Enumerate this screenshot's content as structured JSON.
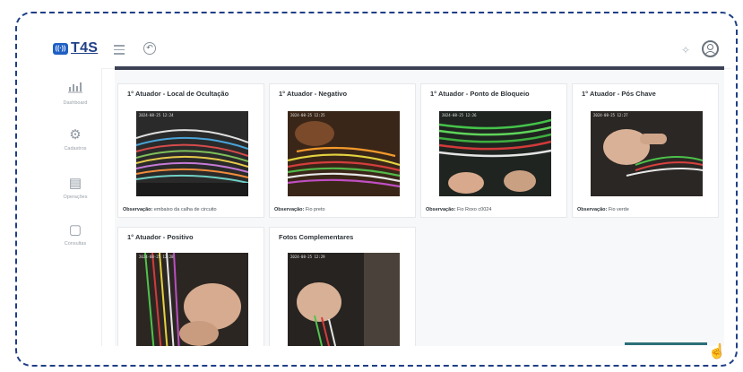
{
  "app": {
    "logo_badge": "((·))",
    "logo_text": "T4S"
  },
  "icons": {
    "menu": "menu-icon",
    "back": "back-icon",
    "sparkle": "sparkle-icon",
    "user": "user-avatar-icon",
    "cursor": "hand-pointer-icon"
  },
  "sidebar": {
    "items": [
      {
        "label": "Dashboard",
        "icon": "chart-icon",
        "glyph": "▥"
      },
      {
        "label": "Cadastros",
        "icon": "gears-icon",
        "glyph": "⚙"
      },
      {
        "label": "Operações",
        "icon": "clipboard-icon",
        "glyph": "▤"
      },
      {
        "label": "Consultas",
        "icon": "document-icon",
        "glyph": "▢"
      }
    ]
  },
  "cards": [
    {
      "title": "1° Atuador - Local de Ocultação",
      "timestamp": "2024-08-25 12:24",
      "obs_label": "Observação:",
      "obs_value": "embaixo da calha de circuito",
      "photo_theme": "wires-multicolor"
    },
    {
      "title": "1° Atuador - Negativo",
      "timestamp": "2024-08-25 12:25",
      "obs_label": "Observação:",
      "obs_value": "Fio preto",
      "photo_theme": "wires-red-green"
    },
    {
      "title": "1° Atuador - Ponto de Bloqueio",
      "timestamp": "2024-08-25 12:26",
      "obs_label": "Observação:",
      "obs_value": "Fio Roxo c0024",
      "photo_theme": "wires-green-hand"
    },
    {
      "title": "1° Atuador - Pós Chave",
      "timestamp": "2024-08-25 12:27",
      "obs_label": "Observação:",
      "obs_value": "Fio verde",
      "photo_theme": "hand-wire"
    },
    {
      "title": "1° Atuador - Positivo",
      "timestamp": "2024-08-25 12:28",
      "obs_label": "",
      "obs_value": "",
      "photo_theme": "hands-wires"
    },
    {
      "title": "Fotos Complementares",
      "timestamp": "2024-08-25 12:29",
      "obs_label": "",
      "obs_value": "",
      "photo_theme": "hands-panel"
    }
  ],
  "colors": {
    "brand": "#1f3f86",
    "content_top_bar": "#3c4254",
    "dashed_border": "#1f3f86",
    "bottom_button": "#2b6f77"
  }
}
